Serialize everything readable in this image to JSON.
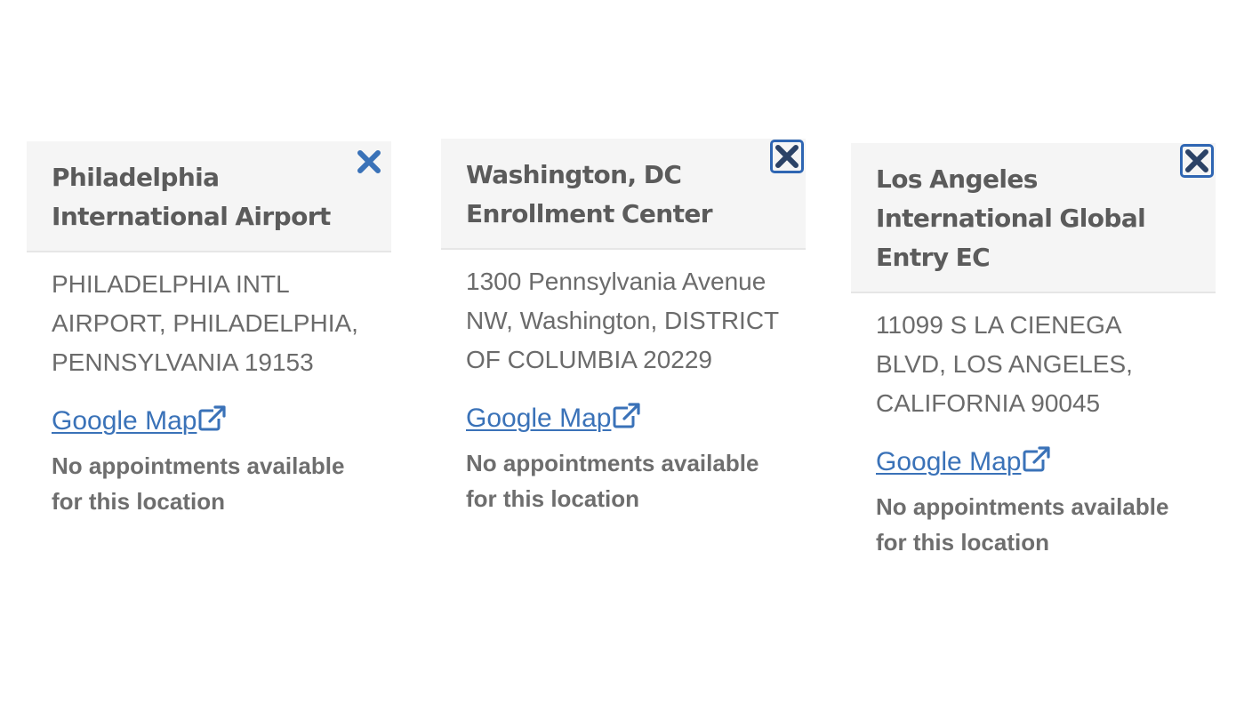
{
  "colors": {
    "header_bg": "#f5f5f5",
    "title_text": "#5b5b5b",
    "body_text": "#6b6b6b",
    "link": "#3a72b8",
    "close_icon_idle": "#3a72b8",
    "close_icon_focused": "#2b4266",
    "focus_ring": "#2f66b3"
  },
  "cards": [
    {
      "title": "Philadelphia International Airport",
      "close_icon": "close-icon",
      "close_focused": false,
      "address": "PHILADELPHIA INTL AIRPORT, PHILADELPHIA, PENNSYLVANIA 19153",
      "map_link": "Google Map",
      "map_link_icon": "external-link-icon",
      "availability": "No appointments available for this location"
    },
    {
      "title": "Washington, DC Enrollment Center",
      "close_icon": "close-icon",
      "close_focused": true,
      "address": "1300 Pennsylvania Avenue NW, Washington, DISTRICT OF COLUMBIA 20229",
      "map_link": "Google Map",
      "map_link_icon": "external-link-icon",
      "availability": "No appointments available for this location"
    },
    {
      "title": "Los Angeles International Global Entry EC",
      "close_icon": "close-icon",
      "close_focused": true,
      "address": "11099 S LA CIENEGA BLVD, LOS ANGELES, CALIFORNIA 90045",
      "map_link": "Google Map",
      "map_link_icon": "external-link-icon",
      "availability": "No appointments available for this location"
    }
  ]
}
